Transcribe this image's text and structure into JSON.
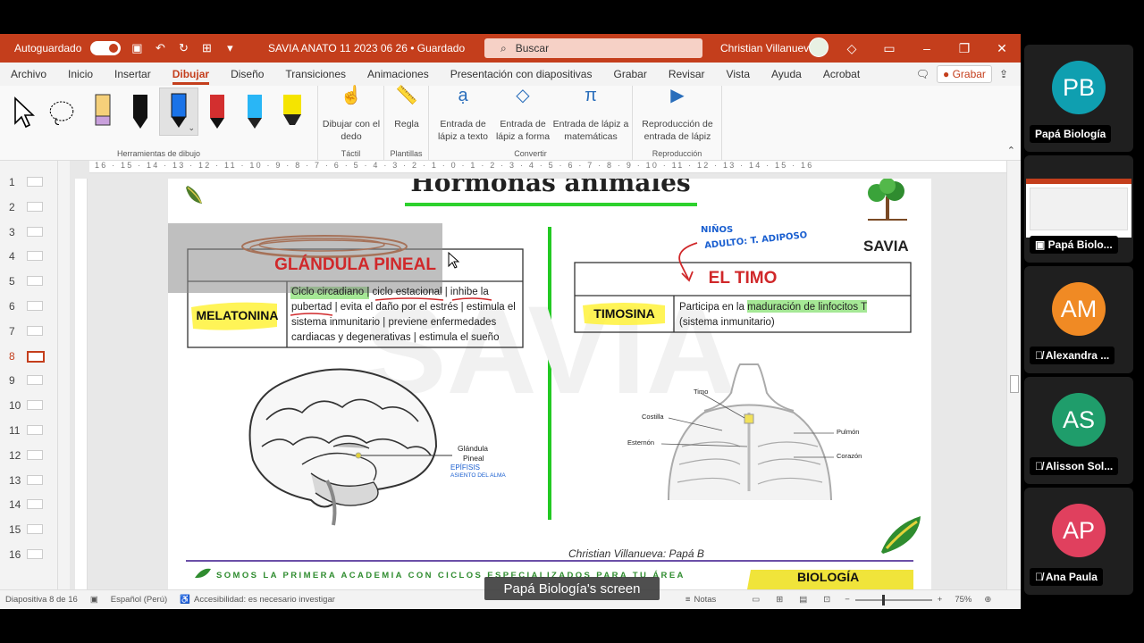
{
  "titlebar": {
    "autosave_label": "Autoguardado",
    "doc_title": "SAVIA ANATO 11 2023 06 26 • Guardado",
    "search_placeholder": "Buscar",
    "user_name": "Christian Villanueva"
  },
  "tabs": [
    "Archivo",
    "Inicio",
    "Insertar",
    "Dibujar",
    "Diseño",
    "Transiciones",
    "Animaciones",
    "Presentación con diapositivas",
    "Grabar",
    "Revisar",
    "Vista",
    "Ayuda",
    "Acrobat"
  ],
  "active_tab": "Dibujar",
  "grabar_button": "Grabar",
  "ribbon": {
    "drawing_tools_label": "Herramientas de dibujo",
    "dibujar_con_dedo": "Dibujar con el dedo",
    "tactil_label": "Táctil",
    "regla": "Regla",
    "plantillas_label": "Plantillas",
    "entrada_texto": "Entrada de lápiz a texto",
    "entrada_forma": "Entrada de lápiz a forma",
    "entrada_matematicas": "Entrada de lápiz a matemáticas",
    "convertir_label": "Convertir",
    "reproduccion": "Reproducción de entrada de lápiz",
    "reproduccion_label": "Reproducción",
    "pen_colors": [
      "#000000",
      "#111111",
      "#1a73e8",
      "#d32f2f",
      "#29b6f6",
      "#f5e400"
    ]
  },
  "thumbnails": [
    "1",
    "2",
    "3",
    "4",
    "5",
    "6",
    "7",
    "8",
    "9",
    "10",
    "11",
    "12",
    "13",
    "14",
    "15",
    "16"
  ],
  "active_slide": "8",
  "ruler_top": "16 · 15 · 14 · 13 · 12 · 11 · 10 · 9 · 8 · 7 · 6 · 5 · 4 · 3 · 2 · 1 · 0 · 1 · 2 · 3 · 4 · 5 · 6 · 7 · 8 · 9 · 10 · 11 · 12 · 13 · 14 · 15 · 16",
  "slide": {
    "title": "Hormonas animales",
    "brand": "SAVIA",
    "watermark": "SAVIA",
    "left_table": {
      "header": "GLÁNDULA PINEAL",
      "hormone": "MELATONINA",
      "description": "Ciclo circadiano | ciclo estacional | inhibe la pubertad | evita el daño por el estrés | estimula el sistema inmunitario | previene enfermedades cardiacas y degenerativas | estimula el sueño"
    },
    "right_table": {
      "header": "EL TIMO",
      "hormone": "TIMOSINA",
      "description": "Participa en la maduración de linfocitos T (sistema inmunitario)"
    },
    "annotation_right_1": "NIÑOS",
    "annotation_right_2": "ADULTO: T. ADIPOSO",
    "brain_label_1": "Glándula",
    "brain_label_2": "Pineal",
    "brain_note_1": "EPÍFISIS",
    "brain_note_2": "ASIENTO DEL ALMA",
    "thymus_labels": {
      "timo": "Timo",
      "costilla": "Costilla",
      "esternon": "Esternón",
      "pulmon": "Pulmón",
      "corazon": "Corazón"
    },
    "author": "Christian Villanueva: Papá B",
    "footer_text": "SOMOS LA PRIMERA ACADEMIA CON CICLOS ESPECIALIZADOS PARA TU ÁREA",
    "footer_badge": "BIOLOGÍA"
  },
  "statusbar": {
    "slide_of": "Diapositiva 8 de 16",
    "language": "Español (Perú)",
    "accessibility": "Accesibilidad: es necesario investigar",
    "notes": "Notas",
    "zoom": "75%"
  },
  "participants": [
    {
      "initials": "PB",
      "name": "Papá Biología",
      "color": "#0f9fb0"
    },
    {
      "initials": "",
      "name": "Papá Biolo...",
      "color": ""
    },
    {
      "initials": "AM",
      "name": "Alexandra ...",
      "color": "#f08a24"
    },
    {
      "initials": "AS",
      "name": "Alisson Sol...",
      "color": "#1f9d6b"
    },
    {
      "initials": "AP",
      "name": "Ana Paula",
      "color": "#e0405e"
    }
  ],
  "screen_caption": "Papá Biología's screen"
}
